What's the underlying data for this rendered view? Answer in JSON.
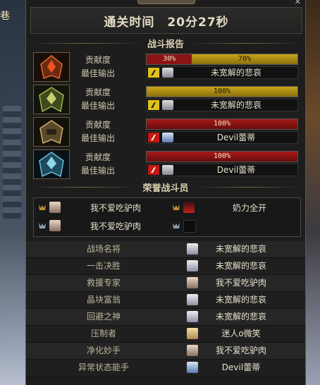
{
  "window": {
    "title_tab": "战斗报告",
    "left_tag": "巷"
  },
  "clear_time_label": "通关时间",
  "clear_time_value": "20分27秒",
  "battle_report_title": "战斗报告",
  "players": [
    {
      "contribution_label": "贡献度",
      "best_output_label": "最佳输出",
      "contribution": [
        {
          "value": "30%",
          "fraction": 0.3,
          "color": "#8a1414"
        },
        {
          "value": "70%",
          "fraction": 0.7,
          "color": "#a88a12"
        }
      ],
      "best_name": "未宽解的悲哀",
      "weapon_color": "#e0c21a",
      "avatar_theme": "red"
    },
    {
      "contribution_label": "贡献度",
      "best_output_label": "最佳输出",
      "contribution": [
        {
          "value": "100%",
          "fraction": 1.0,
          "color": "#a88a12"
        }
      ],
      "best_name": "未宽解的悲哀",
      "weapon_color": "#e0c21a",
      "avatar_theme": "green"
    },
    {
      "contribution_label": "贡献度",
      "best_output_label": "最佳输出",
      "contribution": [
        {
          "value": "100%",
          "fraction": 1.0,
          "color": "#8a1414"
        }
      ],
      "best_name": "Devil蕾蒂",
      "weapon_color": "#c41818",
      "avatar_theme": "gold"
    },
    {
      "contribution_label": "贡献度",
      "best_output_label": "最佳输出",
      "contribution": [
        {
          "value": "100%",
          "fraction": 1.0,
          "color": "#8a1414"
        }
      ],
      "best_name": "Devil蕾蒂",
      "weapon_color": "#c41818",
      "avatar_theme": "blue"
    }
  ],
  "honor_title": "荣誉战斗员",
  "honors": [
    {
      "name": "我不爱吃驴肉"
    },
    {
      "name": "奶力全开"
    },
    {
      "name": "我不爱吃驴肉"
    },
    {
      "name": ""
    }
  ],
  "awards": [
    {
      "title": "战场名将",
      "name": "未宽解的悲哀"
    },
    {
      "title": "一击决胜",
      "name": "未宽解的悲哀"
    },
    {
      "title": "救援专家",
      "name": "我不爱吃驴肉"
    },
    {
      "title": "晶块富翁",
      "name": "未宽解的悲哀"
    },
    {
      "title": "回避之神",
      "name": "未宽解的悲哀"
    },
    {
      "title": "压制者",
      "name": "迷人o微笑"
    },
    {
      "title": "净化妙手",
      "name": "我不爱吃驴肉"
    },
    {
      "title": "异常状态能手",
      "name": "Devil蕾蒂"
    }
  ]
}
